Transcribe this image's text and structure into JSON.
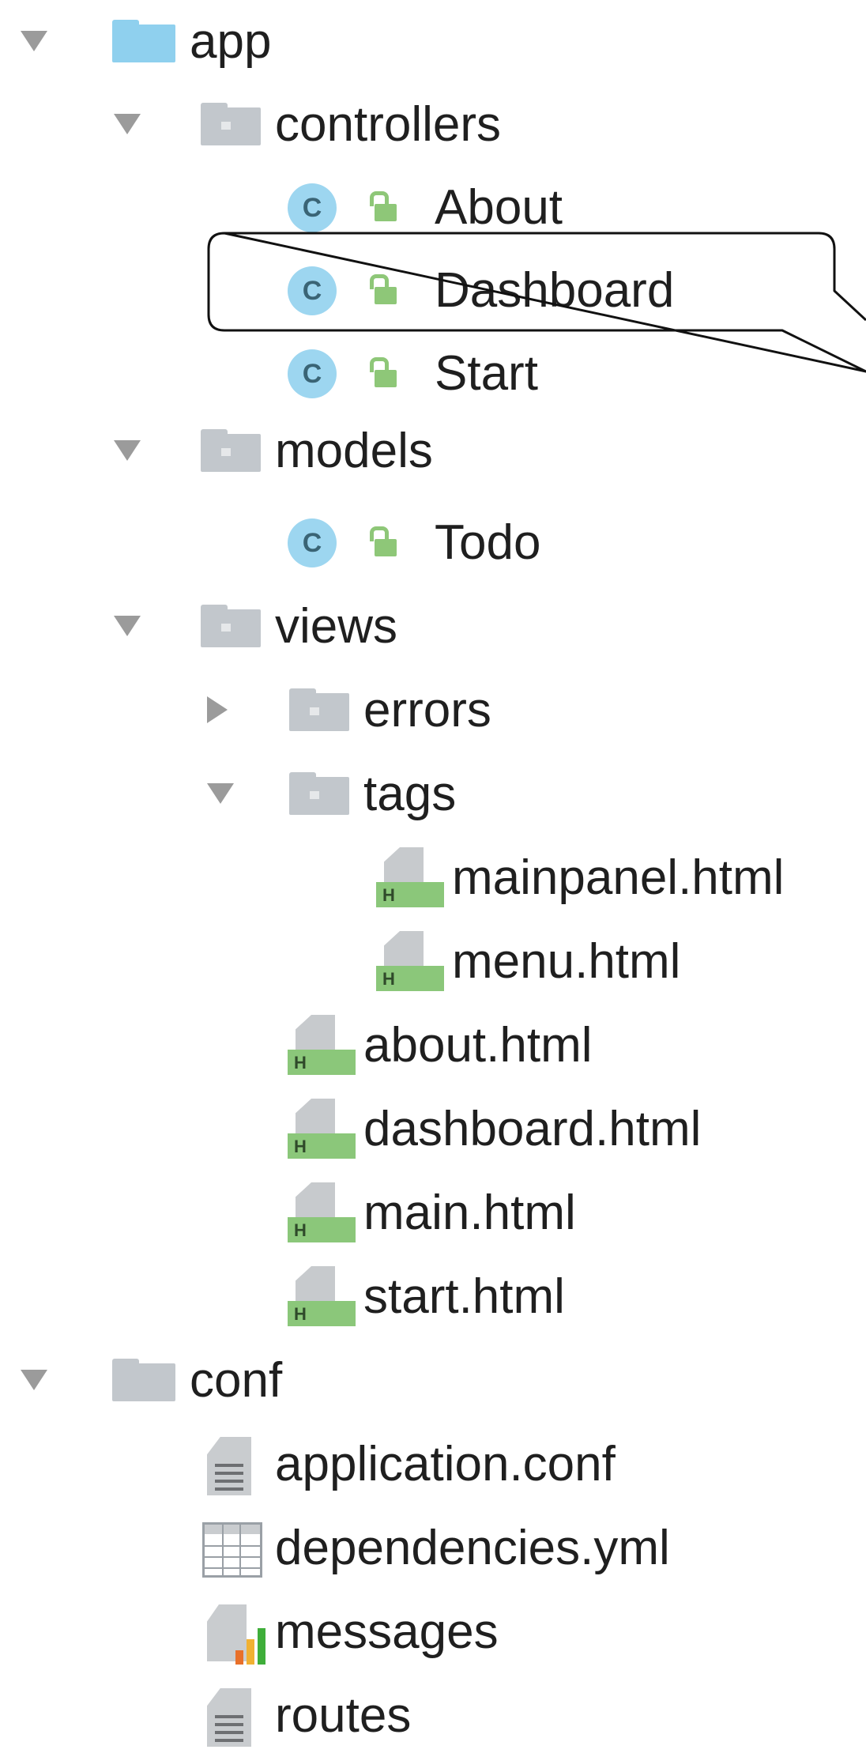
{
  "tree": {
    "app": "app",
    "controllers": "controllers",
    "about": "About",
    "dashboard": "Dashboard",
    "start": "Start",
    "models": "models",
    "todo": "Todo",
    "views": "views",
    "errors": "errors",
    "tags": "tags",
    "mainpanel_html": "mainpanel.html",
    "menu_html": "menu.html",
    "about_html": "about.html",
    "dashboard_html": "dashboard.html",
    "main_html": "main.html",
    "start_html": "start.html",
    "conf": "conf",
    "application_conf": "application.conf",
    "dependencies_yml": "dependencies.yml",
    "messages": "messages",
    "routes": "routes"
  },
  "icons": {
    "class_letter": "C",
    "html_letter": "H"
  },
  "colors": {
    "folder_blue": "#8fd0ee",
    "folder_gray": "#c2c7cc",
    "class_circle": "#9dd6f0",
    "lock_green": "#8ec778"
  }
}
